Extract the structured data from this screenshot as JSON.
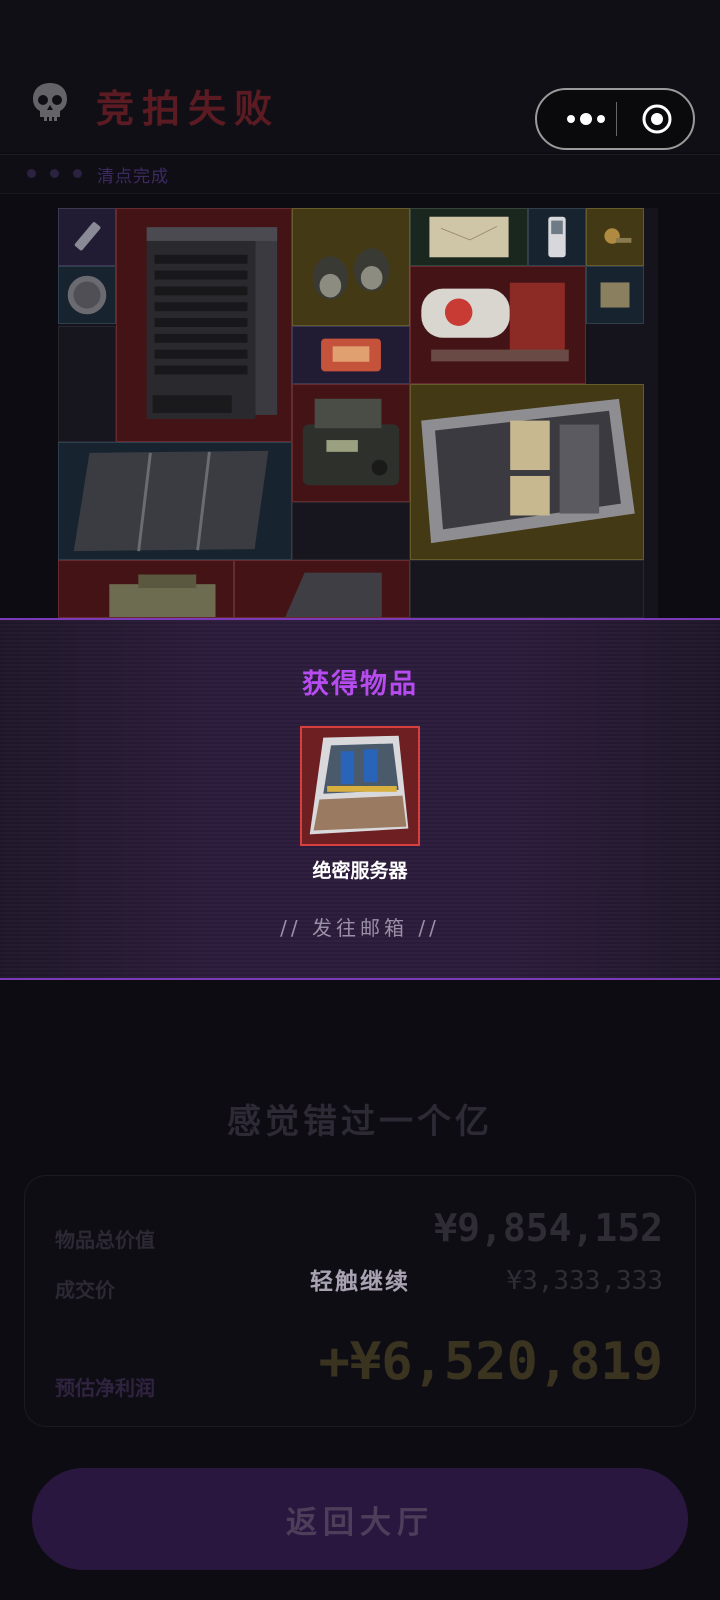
{
  "header": {
    "title": "竞拍失败",
    "skull_icon": "skull-icon",
    "menu_icon": "more-dots-icon",
    "close_icon": "target-circle-icon"
  },
  "status": {
    "text": "清点完成"
  },
  "colors": {
    "accent": "#b64cf0",
    "rarity_red": "#d8403f",
    "rarity_yellow": "#c9a83a",
    "rarity_blue": "#3b6688",
    "rarity_purple": "#6b4bb0",
    "rarity_green": "#4f7a55"
  },
  "result": {
    "heading": "获得物品",
    "item_name": "绝密服务器",
    "item_icon": "server-icon",
    "mail_note": "// 发往邮箱 //"
  },
  "summary": {
    "regret_text": "感觉错过一个亿",
    "total_value_label": "物品总价值",
    "total_value": "¥9,854,152",
    "deal_price_label": "成交价",
    "deal_price": "¥3,333,333",
    "net_profit_label": "预估净利润",
    "net_profit": "+¥6,520,819"
  },
  "tap_hint": "轻触继续",
  "back_button": "返回大厅"
}
